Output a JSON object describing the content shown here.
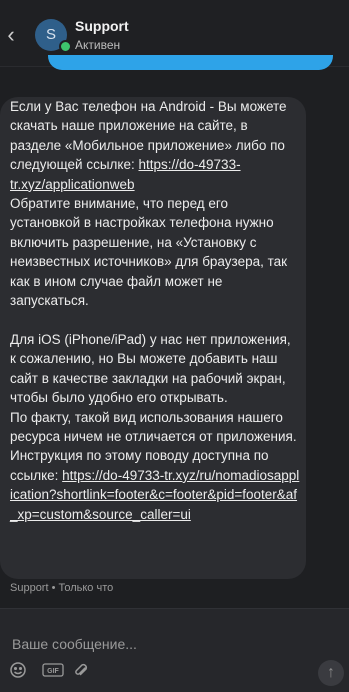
{
  "header": {
    "back_icon": "chevron-left-icon",
    "avatar_letter": "S",
    "name": "Support",
    "status": "Активен"
  },
  "message": {
    "p1": "Если у Вас телефон на Android - Вы можете скачать наше приложение на сайте, в разделе «Мобильное приложение» либо по следующей ссылке: ",
    "link1": "https://do-49733-tr.xyz/applicationweb",
    "p2": "Обратите внимание, что перед его установкой в настройках телефона нужно включить разрешение, на «Установку с неизвестных источников» для браузера, так как в ином случае файл может не запускаться.",
    "p3": "Для iOS (iPhone/iPad) у нас нет приложения, к сожалению, но Вы можете добавить наш сайт в качестве закладки на рабочий экран, чтобы было удобно его открывать.",
    "p4": "По факту, такой вид использования нашего ресурса ничем не отличается от приложения. Инструкция по этому поводу доступна по ссылке: ",
    "link2": "https://do-49733-tr.xyz/ru/nomadiosapplication?shortlink=footer&c=footer&pid=footer&af_xp=custom&source_caller=ui",
    "meta": "Support • Только что"
  },
  "composer": {
    "placeholder": "Ваше сообщение...",
    "emoji_icon": "emoji-icon",
    "gif_label": "GIF",
    "attach_icon": "paperclip-icon",
    "send_icon": "arrow-up-icon"
  },
  "colors": {
    "accent": "#2ea3e8",
    "online": "#3ec46d",
    "background": "#1e1f22",
    "bubble": "#2c2d31"
  }
}
